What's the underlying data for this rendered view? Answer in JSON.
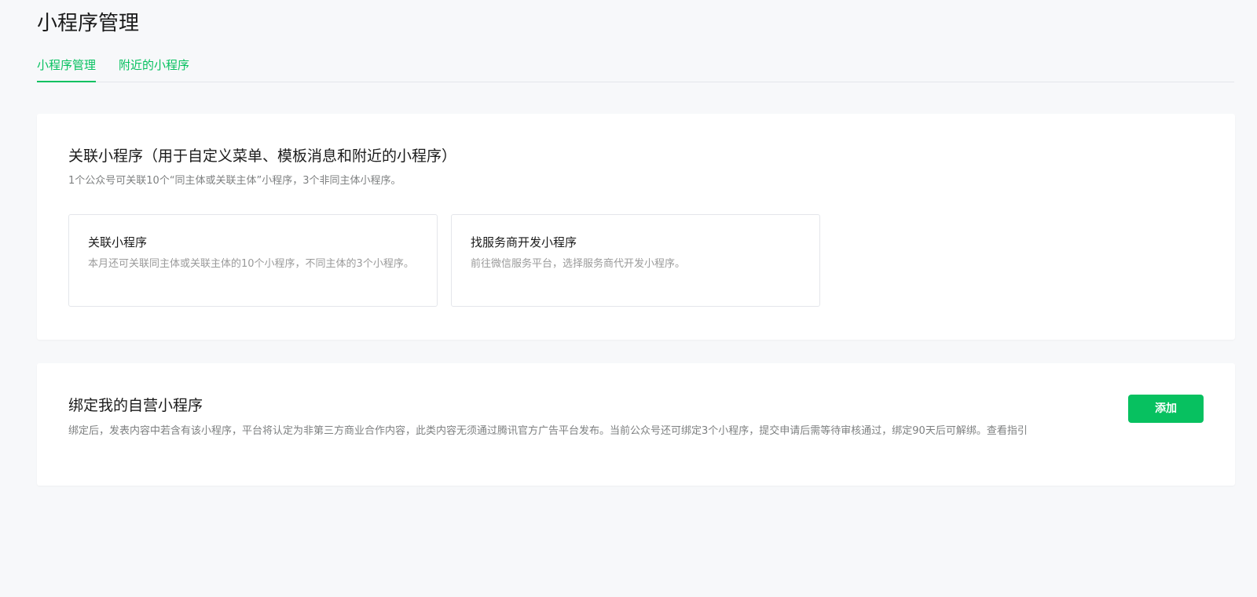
{
  "page": {
    "title": "小程序管理"
  },
  "tabs": [
    {
      "label": "小程序管理",
      "active": true
    },
    {
      "label": "附近的小程序",
      "active": false
    }
  ],
  "link_section": {
    "title": "关联小程序（用于自定义菜单、模板消息和附近的小程序）",
    "description": "1个公众号可关联10个“同主体或关联主体”小程序，3个非同主体小程序。",
    "options": [
      {
        "title": "关联小程序",
        "description": "本月还可关联同主体或关联主体的10个小程序，不同主体的3个小程序。"
      },
      {
        "title": "找服务商开发小程序",
        "description": "前往微信服务平台，选择服务商代开发小程序。"
      }
    ]
  },
  "bind_section": {
    "title": "绑定我的自营小程序",
    "description": "绑定后，发表内容中若含有该小程序，平台将认定为非第三方商业合作内容，此类内容无须通过腾讯官方广告平台发布。当前公众号还可绑定3个小程序，提交申请后需等待审核通过，绑定90天后可解绑。查看指引",
    "add_button_label": "添加"
  },
  "colors": {
    "accent": "#07c160",
    "background": "#f7f8fa",
    "card": "#ffffff",
    "muted_text": "#7e8081"
  }
}
